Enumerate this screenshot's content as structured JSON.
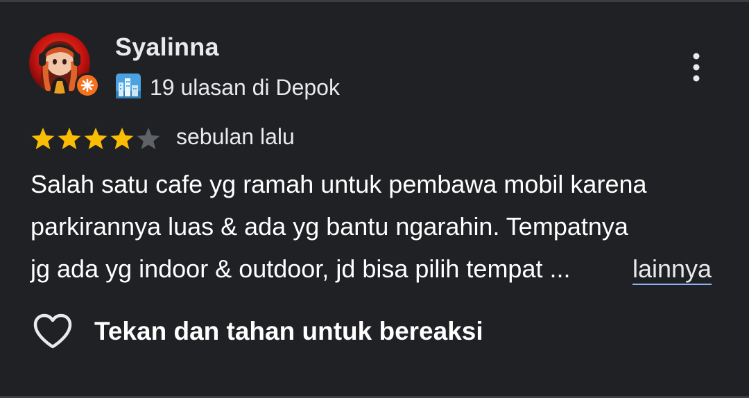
{
  "reviewer": {
    "name": "Syalinna",
    "stats": "19 ulasan di Depok",
    "avatar_icon": "anime-girl-avatar",
    "badge_icon": "local-guide-badge-icon",
    "city_icon": "cityscape-icon"
  },
  "review": {
    "rating": 4,
    "max_rating": 5,
    "time": "sebulan lalu",
    "lines": [
      "Salah satu cafe yg ramah untuk pembawa mobil karena",
      "parkirannya luas & ada yg bantu ngarahin. Tempatnya",
      "jg ada yg indoor & outdoor, jd bisa pilih tempat ..."
    ],
    "more_label": "lainnya"
  },
  "reaction": {
    "label": "Tekan dan tahan untuk bereaksi",
    "icon": "heart-outline-icon"
  },
  "colors": {
    "background": "#202124",
    "star_filled": "#fbbc04",
    "star_empty": "#5f6368",
    "badge": "#f4711f",
    "text": "#e8eaed"
  }
}
